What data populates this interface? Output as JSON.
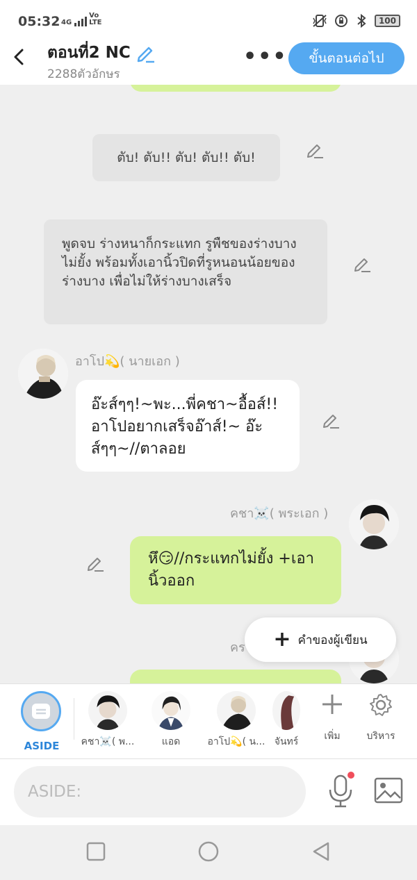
{
  "status": {
    "time": "05:32",
    "network": "4G",
    "volte": "Vo\nLTE",
    "battery": "100"
  },
  "header": {
    "title": "ตอนที่2 NC",
    "char_count": "2288ตัวอักษร",
    "next_label": "ขั้นตอนต่อไป"
  },
  "messages": {
    "narration_1": "ตับ! ตับ!! ตับ! ตับ!! ตับ!",
    "narration_2": "พูดจบ ร่างหนาก็กระแทก รูพืชของร่างบางไม่ยั้ง พร้อมทั้งเอานิ้วปิดที่รูหนอนน้อยของร่างบาง เพื่อไม่ให้ร่างบางเสร็จ",
    "left_name": "อาโป💫( นายเอก )",
    "left_text": "อ๊ะส์ๆๆ!~พะ...พี่คชา~อื้อส์!!อาโปอยากเสร็จอ๊าส์!~ อ๊ะส์ๆๆ~//ตาลอย",
    "right_name": "คชา☠️( พระเอก )",
    "right_text": "หึ😏//กระแทกไม่ยั้ง +เอานิ้วออก",
    "partial_name": "คร"
  },
  "fab": {
    "label": "คำของผู้เขียน"
  },
  "charbar": {
    "aside_label": "ASIDE",
    "chars": [
      {
        "label": "คชา☠️( พ..."
      },
      {
        "label": "แอด"
      },
      {
        "label": "อาโป💫( น..."
      },
      {
        "label": "จันทร์"
      }
    ],
    "add_label": "เพิ่ม",
    "manage_label": "บริหาร"
  },
  "input": {
    "placeholder": "ASIDE:"
  },
  "colors": {
    "accent": "#55a9f1",
    "bubble_green": "#d6f29a",
    "bubble_white": "#ffffff",
    "narration_bg": "#e4e4e4"
  }
}
